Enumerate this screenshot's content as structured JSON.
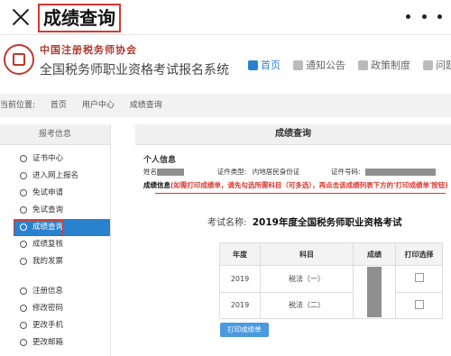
{
  "app": {
    "title": "成绩查询"
  },
  "header": {
    "org_name": "中国注册税务师协会",
    "system_name": "全国税务师职业资格考试报名系统",
    "nav": [
      {
        "label": "首页",
        "icon": "home-icon",
        "active": true
      },
      {
        "label": "通知公告",
        "icon": "notice-icon"
      },
      {
        "label": "政策制度",
        "icon": "policy-icon"
      },
      {
        "label": "问题解",
        "icon": "question-icon"
      }
    ]
  },
  "breadcrumb": {
    "label": "当前位置:",
    "items": [
      "首页",
      "用户中心",
      "成绩查询"
    ]
  },
  "sidebar": {
    "header": "报考信息",
    "items": [
      "证书中心",
      "进入网上报名",
      "免试申请",
      "免试查询",
      "成绩查询",
      "成绩复核",
      "我的发票"
    ],
    "items2": [
      "注册信息",
      "修改密码",
      "更改手机",
      "更改邮箱"
    ]
  },
  "main": {
    "panel_title": "成绩查询",
    "personal_title": "个人信息",
    "name_label": "姓名",
    "id_type_label": "证件类型:",
    "id_type_value": "内地居民身份证",
    "id_no_label": "证件号码:",
    "score_info_label": "成绩信息",
    "score_info_hint": "(如需打印成绩单，请先勾选所需科目（可多选），再点击该成绩列表下方的'打印成绩单'按钮)",
    "exam_label": "考试名称:",
    "exam_value": "2019年度全国税务师职业资格考试",
    "table": {
      "headers": [
        "年度",
        "科目",
        "成绩",
        "打印选择"
      ],
      "rows": [
        {
          "year": "2019",
          "subject": "税法（一）"
        },
        {
          "year": "2019",
          "subject": "税法（二）"
        }
      ]
    },
    "print_button": "打印成绩单"
  },
  "colors": {
    "accent": "#2a82cf",
    "highlight": "#d9382f"
  }
}
